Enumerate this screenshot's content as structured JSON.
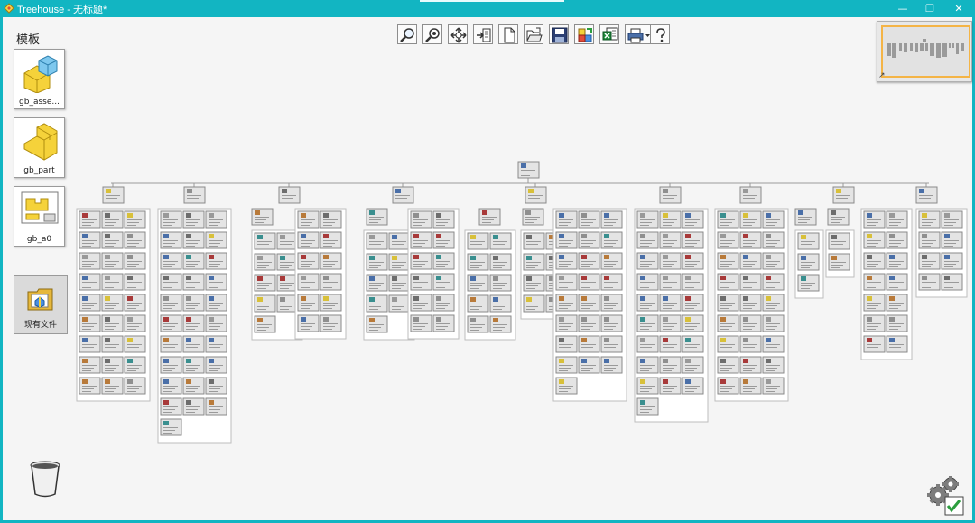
{
  "window": {
    "title": "Treehouse - 无标题*",
    "min_symbol": "—",
    "restore_symbol": "❐",
    "close_symbol": "✕"
  },
  "sidebar": {
    "title": "模板",
    "templates": [
      {
        "label": "gb_asse...",
        "icon": "assembly-icon"
      },
      {
        "label": "gb_part",
        "icon": "part-icon"
      },
      {
        "label": "gb_a0",
        "icon": "drawing-icon"
      }
    ],
    "existing_files_label": "现有文件"
  },
  "toolbar": {
    "buttons": [
      {
        "name": "zoom-fit-button",
        "icon": "zoom-icon"
      },
      {
        "name": "zoom-selection-button",
        "icon": "zoom-selection-icon"
      },
      {
        "name": "pan-button",
        "icon": "pan-icon"
      },
      {
        "name": "import-button",
        "icon": "import-icon"
      },
      {
        "name": "new-document-button",
        "icon": "new-document-icon"
      },
      {
        "name": "open-button",
        "icon": "open-folder-icon"
      },
      {
        "name": "save-button",
        "icon": "save-icon"
      },
      {
        "name": "export-button",
        "icon": "export-icon"
      },
      {
        "name": "excel-export-button",
        "icon": "excel-export-icon"
      },
      {
        "name": "print-button",
        "icon": "print-icon"
      },
      {
        "name": "help-button",
        "icon": "help-icon"
      }
    ]
  },
  "tree": {
    "root": "root-assembly",
    "branches": [
      {
        "cols": 3,
        "rows": 9,
        "extra": 0
      },
      {
        "cols": 3,
        "rows": 10,
        "extra": 1
      },
      {
        "cols": 2,
        "rows": 4,
        "extra": 1
      },
      {
        "cols": 2,
        "rows": 6,
        "extra": 0
      },
      {
        "cols": 2,
        "rows": 4,
        "extra": 1
      },
      {
        "cols": 2,
        "rows": 6,
        "extra": 0
      },
      {
        "cols": 2,
        "rows": 5,
        "extra": 0
      },
      {
        "cols": 2,
        "rows": 4,
        "extra": 0
      },
      {
        "cols": 3,
        "rows": 8,
        "extra": 1
      },
      {
        "cols": 3,
        "rows": 9,
        "extra": 1
      },
      {
        "cols": 3,
        "rows": 9,
        "extra": 0
      },
      {
        "cols": 1,
        "rows": 2,
        "extra": 1
      },
      {
        "cols": 1,
        "rows": 2,
        "extra": 0
      },
      {
        "cols": 2,
        "rows": 7,
        "extra": 0
      },
      {
        "cols": 2,
        "rows": 4,
        "extra": 0
      }
    ]
  }
}
